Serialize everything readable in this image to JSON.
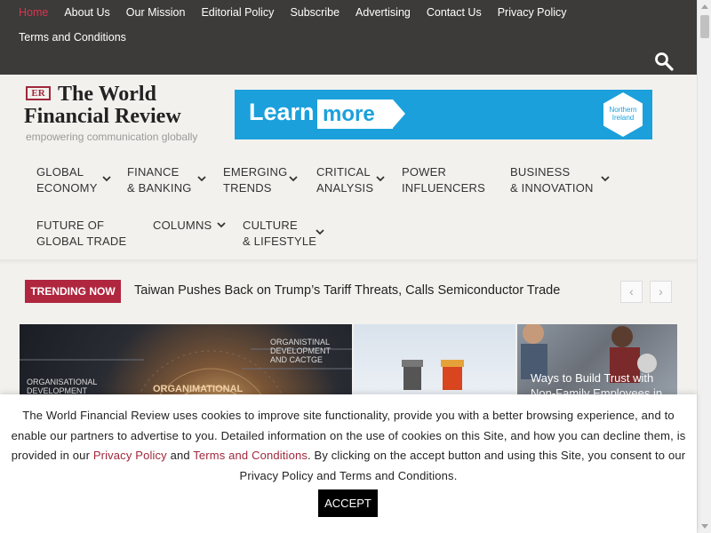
{
  "topnav": {
    "links": [
      "Home",
      "About Us",
      "Our Mission",
      "Editorial Policy",
      "Subscribe",
      "Advertising",
      "Contact Us",
      "Privacy Policy",
      "Terms and Conditions"
    ],
    "active_link": "Home"
  },
  "logo": {
    "mark": "ER",
    "line1": "The World",
    "line2": "Financial Review",
    "tagline": "empowering communication globally"
  },
  "banner": {
    "learn": "Learn",
    "more": "more",
    "badge_line1": "Northern",
    "badge_line2": "Ireland"
  },
  "mainnav": {
    "items": [
      {
        "line1": "GLOBAL",
        "line2": "ECONOMY"
      },
      {
        "line1": "FINANCE",
        "line2": "& BANKING"
      },
      {
        "line1": "EMERGING",
        "line2": "TRENDS"
      },
      {
        "line1": "CRITICAL",
        "line2": "ANALYSIS"
      },
      {
        "line1": "POWER",
        "line2": "INFLUENCERS"
      },
      {
        "line1": "BUSINESS",
        "line2": "& INNOVATION"
      },
      {
        "line1": "FUTURE OF",
        "line2": "GLOBAL TRADE"
      },
      {
        "line1": "COLUMNS",
        "line2": ""
      },
      {
        "line1": "CULTURE",
        "line2": "& LIFESTYLE"
      }
    ]
  },
  "trending": {
    "badge": "TRENDING NOW",
    "headline": "Taiwan Pushes Back on Trump’s Tariff Threats, Calls Semiconductor Trade",
    "prev": "‹",
    "next": "›"
  },
  "articles": {
    "img1_label1": "ORGANISATIONAL",
    "img1_label2": "DEVELOPMENT",
    "img1_label3": "ORGANIMATIONAL",
    "img1_label4": "ORGANISTINAL",
    "img1_label5": "DEVELOPMENT",
    "img1_label6": "AND CACTGE",
    "img3_caption": "Ways to Build Trust with Non-Family Employees in"
  },
  "cookie": {
    "text_part1": "The World Financial Review uses cookies to improve site functionality, provide you with a better browsing experience, and to enable our partners to advertise to you. Detailed information on the use of cookies on this Site, and how you can decline them, is provided in our ",
    "privacy_link": "Privacy Policy",
    "text_and": " and ",
    "terms_link": "Terms and Conditions",
    "text_part2": ". By clicking on the accept button and using this Site, you consent to our Privacy Policy and Terms and Conditions.",
    "accept": "ACCEPT"
  },
  "colors": {
    "topbar": "#3c3b39",
    "accent": "#b0263f",
    "banner": "#1ba0dc"
  }
}
